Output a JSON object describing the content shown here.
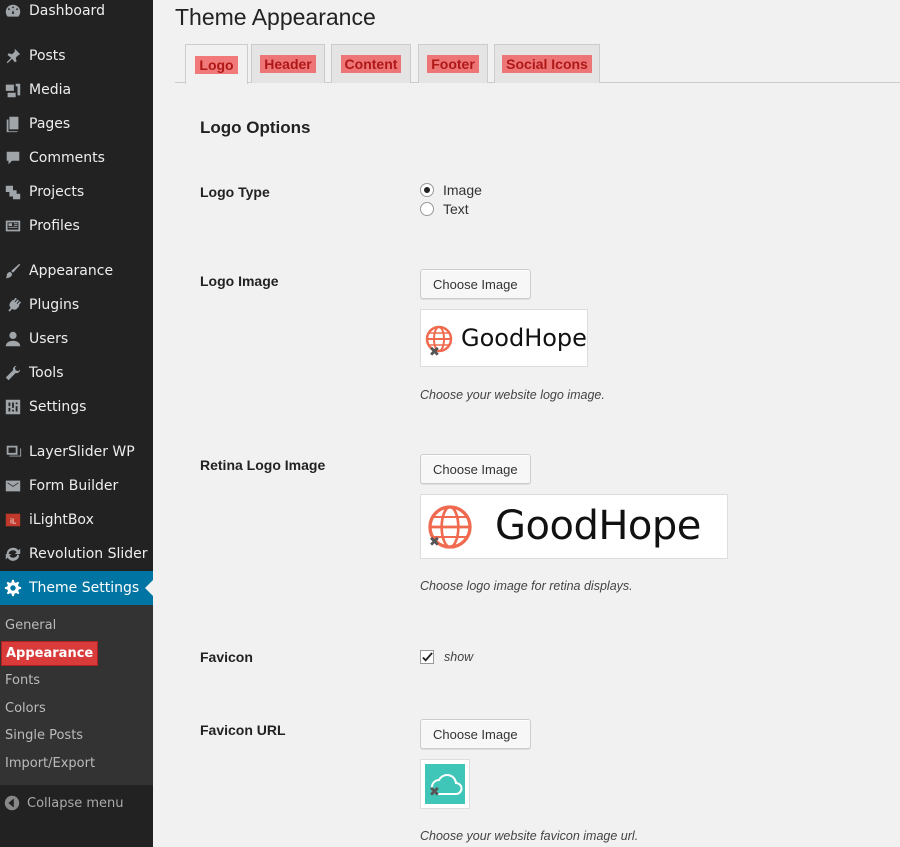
{
  "sidebar": {
    "items": [
      {
        "label": "Dashboard",
        "icon": "dashboard-icon"
      },
      {
        "label": "Posts",
        "icon": "pin-icon"
      },
      {
        "label": "Media",
        "icon": "media-icon"
      },
      {
        "label": "Pages",
        "icon": "pages-icon"
      },
      {
        "label": "Comments",
        "icon": "comment-icon"
      },
      {
        "label": "Projects",
        "icon": "projects-icon"
      },
      {
        "label": "Profiles",
        "icon": "profiles-icon"
      },
      {
        "label": "Appearance",
        "icon": "brush-icon"
      },
      {
        "label": "Plugins",
        "icon": "plug-icon"
      },
      {
        "label": "Users",
        "icon": "user-icon"
      },
      {
        "label": "Tools",
        "icon": "wrench-icon"
      },
      {
        "label": "Settings",
        "icon": "settings-icon"
      },
      {
        "label": "LayerSlider WP",
        "icon": "layers-icon"
      },
      {
        "label": "Form Builder",
        "icon": "mail-icon"
      },
      {
        "label": "iLightBox",
        "icon": "ilightbox-icon"
      },
      {
        "label": "Revolution Slider",
        "icon": "refresh-icon"
      },
      {
        "label": "Theme Settings",
        "icon": "gear-icon"
      }
    ],
    "submenu": [
      "General",
      "Appearance",
      "Fonts",
      "Colors",
      "Single Posts",
      "Import/Export"
    ],
    "collapse_label": "Collapse menu"
  },
  "page": {
    "title": "Theme Appearance",
    "tabs": [
      "Logo",
      "Header",
      "Content",
      "Footer",
      "Social Icons"
    ],
    "section_title": "Logo Options"
  },
  "logo_type": {
    "label": "Logo Type",
    "options": [
      "Image",
      "Text"
    ],
    "selected": "Image"
  },
  "logo_image": {
    "label": "Logo Image",
    "button": "Choose Image",
    "brand_text": "GoodHope",
    "description": "Choose your website logo image."
  },
  "retina_logo": {
    "label": "Retina Logo Image",
    "button": "Choose Image",
    "brand_text": "GoodHope",
    "description": "Choose logo image for retina displays."
  },
  "favicon": {
    "label": "Favicon",
    "checkbox_label": "show",
    "checked": true
  },
  "favicon_url": {
    "label": "Favicon URL",
    "button": "Choose Image",
    "description": "Choose your website favicon image url."
  },
  "colors": {
    "sidebar_bg": "#222222",
    "submenu_bg": "#333333",
    "active_bg": "#0074a2",
    "tab_highlight": "#f05050",
    "logo_accent": "#f06a4f",
    "favicon_bg": "#3fc6b8"
  }
}
